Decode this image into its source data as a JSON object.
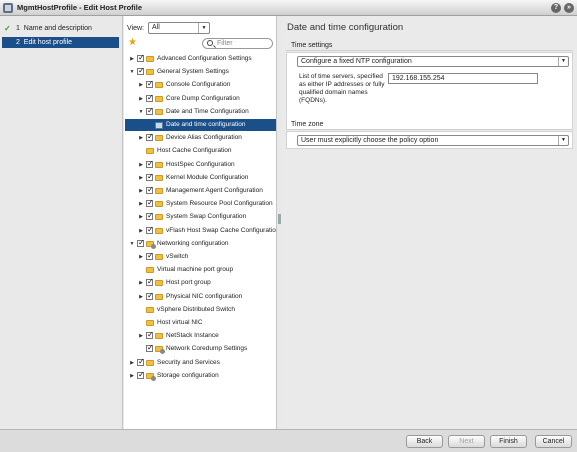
{
  "window": {
    "title": "MgmtHostProfile - Edit Host Profile",
    "help_label": "?",
    "close_label": "»"
  },
  "steps": [
    {
      "num": "1",
      "label": "Name and description",
      "done": true
    },
    {
      "num": "2",
      "label": "Edit host profile",
      "done": false
    }
  ],
  "tree": {
    "view_label": "View:",
    "view_value": "All",
    "filter_placeholder": "Filter",
    "rows": [
      {
        "label": "Advanced Configuration Settings",
        "depth": 0,
        "toggle": "collapsed",
        "checked": true,
        "icon": "folder"
      },
      {
        "label": "General System Settings",
        "depth": 0,
        "toggle": "expanded",
        "checked": true,
        "icon": "folder"
      },
      {
        "label": "Console Configuration",
        "depth": 1,
        "toggle": "collapsed",
        "checked": true,
        "icon": "folder"
      },
      {
        "label": "Core Dump Configuration",
        "depth": 1,
        "toggle": "collapsed",
        "checked": true,
        "icon": "folder"
      },
      {
        "label": "Date and Time Configuration",
        "depth": 1,
        "toggle": "expanded",
        "checked": true,
        "icon": "folder"
      },
      {
        "label": "Date and time configuration",
        "depth": 2,
        "toggle": "none",
        "checked": null,
        "icon": "item",
        "selected": true
      },
      {
        "label": "Device Alias Configuration",
        "depth": 1,
        "toggle": "collapsed",
        "checked": true,
        "icon": "folder"
      },
      {
        "label": "Host Cache Configuration",
        "depth": 1,
        "toggle": "none",
        "checked": null,
        "icon": "folder"
      },
      {
        "label": "HostSpec Configuration",
        "depth": 1,
        "toggle": "collapsed",
        "checked": true,
        "icon": "folder"
      },
      {
        "label": "Kernel Module Configuration",
        "depth": 1,
        "toggle": "collapsed",
        "checked": true,
        "icon": "folder"
      },
      {
        "label": "Management Agent Configuration",
        "depth": 1,
        "toggle": "collapsed",
        "checked": true,
        "icon": "folder"
      },
      {
        "label": "System Resource Pool Configuration",
        "depth": 1,
        "toggle": "collapsed",
        "checked": true,
        "icon": "folder"
      },
      {
        "label": "System Swap Configuration",
        "depth": 1,
        "toggle": "collapsed",
        "checked": true,
        "icon": "folder"
      },
      {
        "label": "vFlash Host Swap Cache Configuration",
        "depth": 1,
        "toggle": "collapsed",
        "checked": true,
        "icon": "folder"
      },
      {
        "label": "Networking configuration",
        "depth": 0,
        "toggle": "expanded",
        "checked": true,
        "icon": "cfg"
      },
      {
        "label": "vSwitch",
        "depth": 1,
        "toggle": "collapsed",
        "checked": true,
        "icon": "folder"
      },
      {
        "label": "Virtual machine port group",
        "depth": 1,
        "toggle": "none",
        "checked": null,
        "icon": "folder"
      },
      {
        "label": "Host port group",
        "depth": 1,
        "toggle": "collapsed",
        "checked": true,
        "icon": "folder"
      },
      {
        "label": "Physical NIC configuration",
        "depth": 1,
        "toggle": "collapsed",
        "checked": true,
        "icon": "folder"
      },
      {
        "label": "vSphere Distributed Switch",
        "depth": 1,
        "toggle": "none",
        "checked": null,
        "icon": "folder"
      },
      {
        "label": "Host virtual NIC",
        "depth": 1,
        "toggle": "none",
        "checked": null,
        "icon": "folder"
      },
      {
        "label": "NetStack Instance",
        "depth": 1,
        "toggle": "collapsed",
        "checked": true,
        "icon": "folder"
      },
      {
        "label": "Network Coredump Settings",
        "depth": 1,
        "toggle": "none",
        "checked": true,
        "icon": "cfg"
      },
      {
        "label": "Security and Services",
        "depth": 0,
        "toggle": "collapsed",
        "checked": true,
        "icon": "folder"
      },
      {
        "label": "Storage configuration",
        "depth": 0,
        "toggle": "collapsed",
        "checked": true,
        "icon": "cfg"
      }
    ]
  },
  "main": {
    "title": "Date and time configuration",
    "time_settings": {
      "header": "Time settings",
      "policy_value": "Configure a fixed NTP configuration",
      "servers_description": "List of time servers, specified as either IP addresses or fully qualified domain names (FQDNs).",
      "servers_value": "192.168.155.254"
    },
    "time_zone": {
      "header": "Time zone",
      "policy_value": "User must explicitly choose the policy option"
    }
  },
  "footer": {
    "back": "Back",
    "next": "Next",
    "finish": "Finish",
    "cancel": "Cancel"
  }
}
